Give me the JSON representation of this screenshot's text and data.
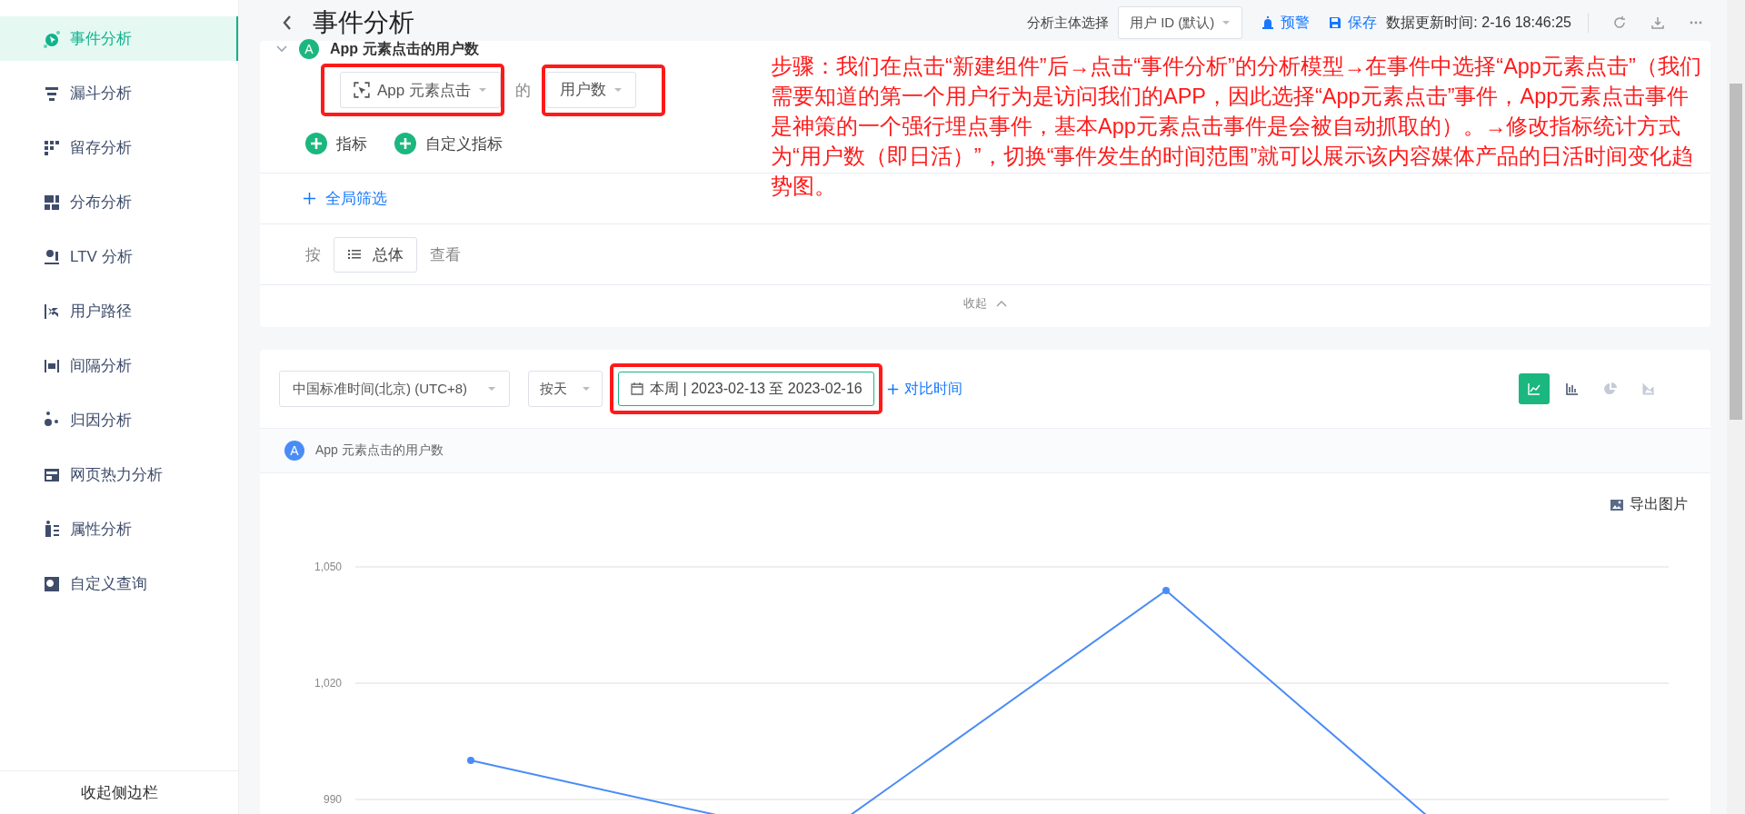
{
  "sidebar": {
    "items": [
      {
        "label": "事件分析",
        "selected": true
      },
      {
        "label": "漏斗分析",
        "selected": false
      },
      {
        "label": "留存分析",
        "selected": false
      },
      {
        "label": "分布分析",
        "selected": false
      },
      {
        "label": "LTV 分析",
        "selected": false
      },
      {
        "label": "用户路径",
        "selected": false
      },
      {
        "label": "间隔分析",
        "selected": false
      },
      {
        "label": "归因分析",
        "selected": false
      },
      {
        "label": "网页热力分析",
        "selected": false
      },
      {
        "label": "属性分析",
        "selected": false
      },
      {
        "label": "自定义查询",
        "selected": false
      }
    ],
    "collapse_label": "收起侧边栏"
  },
  "header": {
    "title": "事件分析",
    "subject_label": "分析主体选择",
    "subject_select": "用户 ID (默认)",
    "alert": "预警",
    "save": "保存",
    "update_time": "数据更新时间: 2-16 18:46:25"
  },
  "metric": {
    "badge": "A",
    "title": "App 元素点击的用户数",
    "event_select": "App 元素点击",
    "of": "的",
    "measure_select": "用户数",
    "add_buttons": [
      "指标",
      "自定义指标"
    ]
  },
  "global_filter": "全局筛选",
  "group": {
    "prefix": "按",
    "value": "总体",
    "suffix": "查看"
  },
  "collapse": "收起",
  "toolbar": {
    "timezone": "中国标准时间(北京) (UTC+8)",
    "granularity": "按天",
    "date_range": "本周 | 2023-02-13 至 2023-02-16",
    "compare": "对比时间",
    "chart_types": [
      {
        "kind": "line",
        "selected": true
      },
      {
        "kind": "bar",
        "selected": false
      },
      {
        "kind": "pie",
        "selected": false
      },
      {
        "kind": "area",
        "selected": false
      }
    ]
  },
  "legend": {
    "badge": "A",
    "label": "App 元素点击的用户数"
  },
  "export": "导出图片",
  "chart": {
    "y_labels": [
      "1,050",
      "1,020",
      "990"
    ]
  },
  "annotation": "步骤：我们在点击“新建组件”后→点击“事件分析”的分析模型→在事件中选择“App元素点击”（我们需要知道的第一个用户行为是访问我们的APP，因此选择“App元素点击”事件，App元素点击事件是神策的一个强行埋点事件，基本App元素点击事件是会被自动抓取的）。→修改指标统计方式为“用户数（即日活）”，切换“事件发生的时间范围”就可以展示该内容媒体产品的日活时间变化趋势图。"
}
